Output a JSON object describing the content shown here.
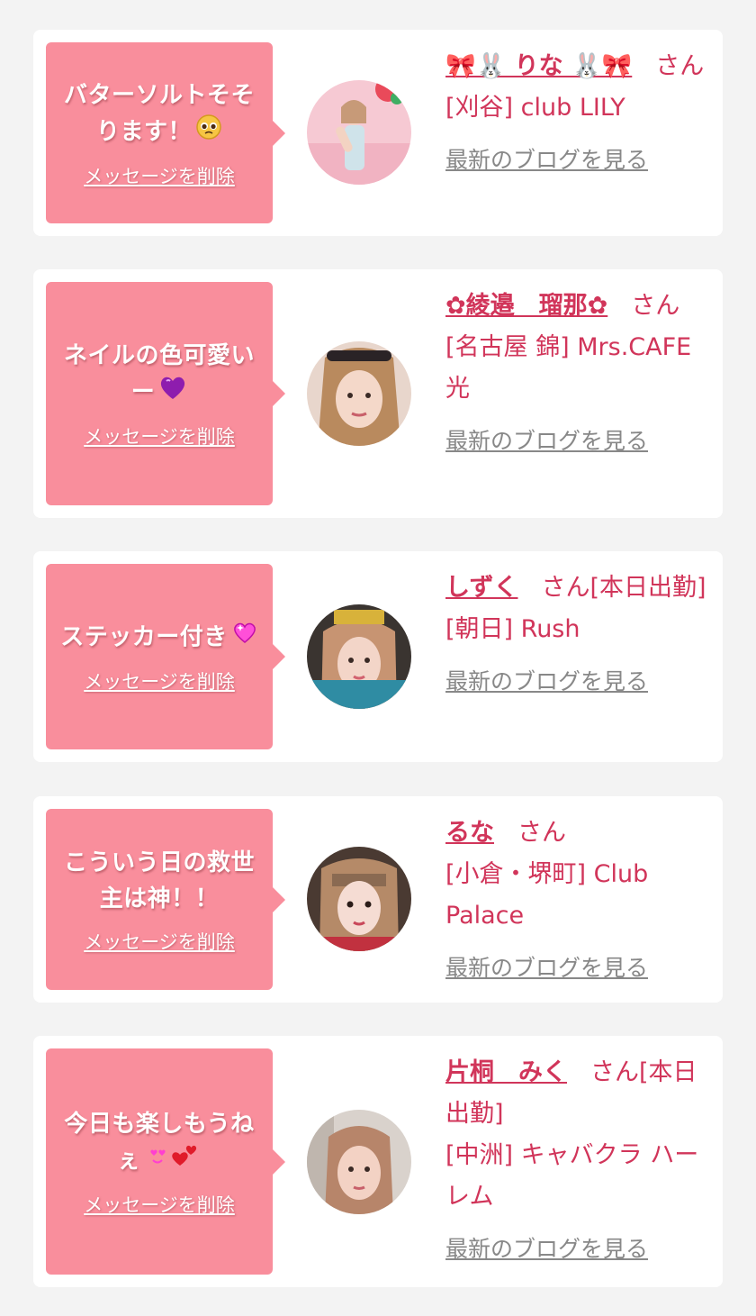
{
  "colors": {
    "background": "#f3f3f3",
    "card": "#ffffff",
    "bubble": "#f98e9c",
    "name": "#d1355a",
    "blog_link": "#888888"
  },
  "cards": [
    {
      "message": "バターソルトそそります！",
      "message_emoji": "pleading-face-icon",
      "delete_label": "メッセージを削除",
      "name": "🎀🐰 りな 🐰🎀",
      "suffix": "さん",
      "shop": "[刈谷] club LILY",
      "blog_label": "最新のブログを見る"
    },
    {
      "message": "ネイルの色可愛いー",
      "message_emoji": "purple-heart-icon",
      "delete_label": "メッセージを削除",
      "name": "✿綾邉　瑠那✿",
      "suffix": "さん",
      "shop": "[名古屋 錦] Mrs.CAFE 光",
      "blog_label": "最新のブログを見る"
    },
    {
      "message": "ステッカー付き",
      "message_emoji": "sparkling-heart-icon",
      "delete_label": "メッセージを削除",
      "name": "しずく",
      "suffix": "さん[本日出勤]",
      "shop": "[朝日] Rush",
      "blog_label": "最新のブログを見る"
    },
    {
      "message": "こういう日の救世主は神！！",
      "message_emoji": "",
      "delete_label": "メッセージを削除",
      "name": "るな",
      "suffix": "さん",
      "shop": "[小倉・堺町] Club Palace",
      "blog_label": "最新のブログを見る"
    },
    {
      "message": "今日も楽しもうねぇ",
      "message_emoji": "heart-eyes-and-hearts-icon",
      "delete_label": "メッセージを削除",
      "name": "片桐　みく",
      "suffix": "さん[本日出勤]",
      "shop": "[中洲] キャバクラ ハーレム",
      "blog_label": "最新のブログを見る"
    }
  ]
}
